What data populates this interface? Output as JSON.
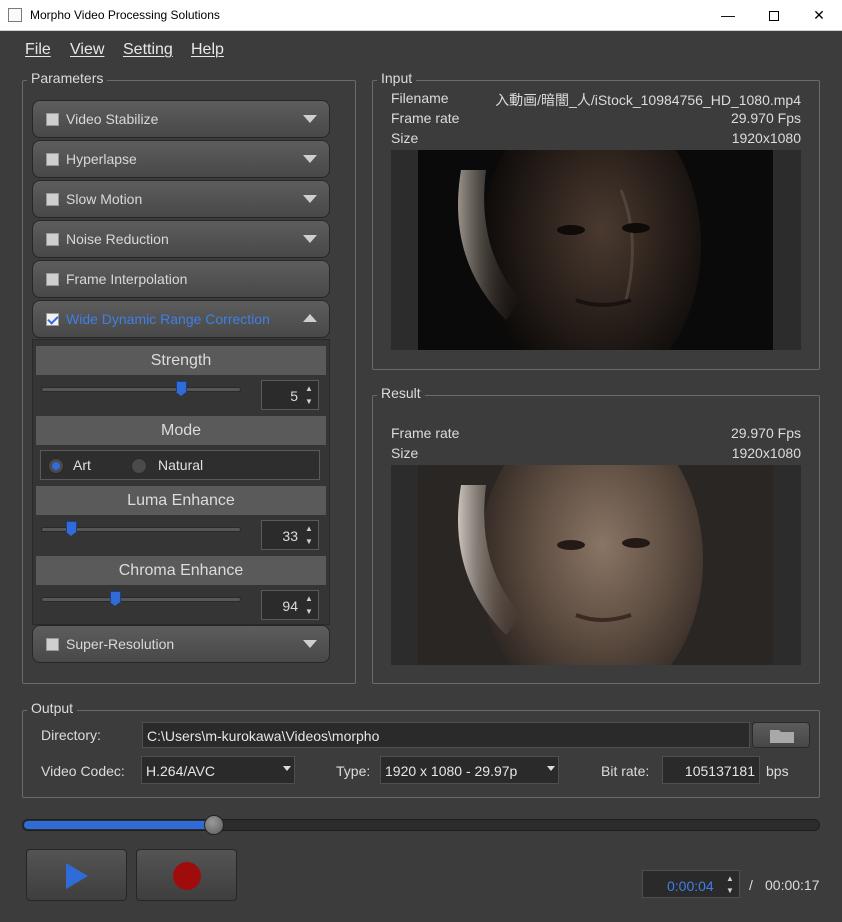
{
  "window": {
    "title": "Morpho Video Processing Solutions",
    "minimize": "—",
    "close": "✕"
  },
  "menu": [
    {
      "label": "File"
    },
    {
      "label": "View"
    },
    {
      "label": "Setting"
    },
    {
      "label": "Help"
    }
  ],
  "parameters": {
    "title": "Parameters",
    "items": [
      {
        "label": "Video Stabilize",
        "checked": false
      },
      {
        "label": "Hyperlapse",
        "checked": false
      },
      {
        "label": "Slow Motion",
        "checked": false
      },
      {
        "label": "Noise Reduction",
        "checked": false
      },
      {
        "label": "Frame Interpolation",
        "checked": false
      },
      {
        "label": "Wide Dynamic Range Correction",
        "checked": true
      },
      {
        "label": "Super-Resolution",
        "checked": false
      }
    ],
    "wdr": {
      "strength": {
        "label": "Strength",
        "value": "5",
        "level": 0.7
      },
      "mode": {
        "label": "Mode",
        "options": [
          "Art",
          "Natural"
        ],
        "selected": "Art"
      },
      "luma": {
        "label": "Luma Enhance",
        "value": "33",
        "level": 0.15
      },
      "chroma": {
        "label": "Chroma Enhance",
        "value": "94",
        "level": 0.37
      }
    }
  },
  "input": {
    "title": "Input",
    "filename_label": "Filename",
    "filename": "入動画/暗闇_人/iStock_10984756_HD_1080.mp4",
    "framerate_label": "Frame rate",
    "framerate": "29.970 Fps",
    "size_label": "Size",
    "size": "1920x1080"
  },
  "result": {
    "title": "Result",
    "framerate_label": "Frame rate",
    "framerate": "29.970 Fps",
    "size_label": "Size",
    "size": "1920x1080"
  },
  "output": {
    "title": "Output",
    "directory_label": "Directory:",
    "directory": "C:\\Users\\m-kurokawa\\Videos\\morpho",
    "codec_label": "Video Codec:",
    "codec": "H.264/AVC",
    "type_label": "Type:",
    "type": "1920 x 1080 - 29.97p",
    "bitrate_label": "Bit rate:",
    "bitrate": "105137181",
    "bitrate_unit": "bps"
  },
  "playback": {
    "progress": 0.24,
    "current_time": "0:00:04",
    "separator": "/",
    "total_time": "00:00:17"
  },
  "colors": {
    "accent": "#2f6cd8",
    "record": "#a00c0c",
    "background": "#3c3c3c"
  }
}
